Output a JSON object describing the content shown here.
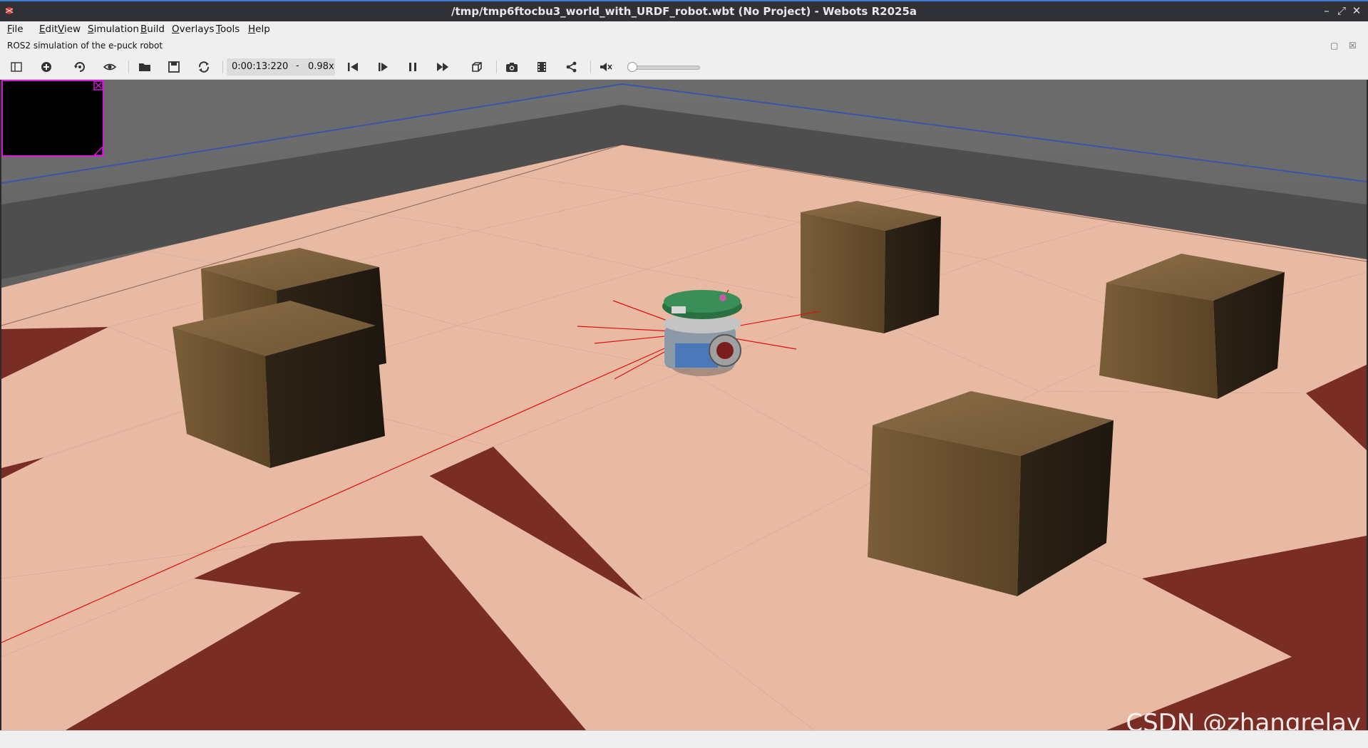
{
  "window": {
    "title": "/tmp/tmp6ftocbu3_world_with_URDF_robot.wbt (No Project) - Webots R2025a",
    "controls": [
      "minimize-icon",
      "maximize-icon",
      "close-icon"
    ]
  },
  "menu": {
    "items": [
      "File",
      "Edit",
      "View",
      "Simulation",
      "Build",
      "Overlays",
      "Tools",
      "Help"
    ]
  },
  "info": {
    "description": "ROS2 simulation of the e-puck robot"
  },
  "toolbar": {
    "icons": [
      "scene-tree-toggle-icon",
      "add-node-icon",
      "reload-controller-icon",
      "view-eye-icon",
      "open-world-icon",
      "save-world-icon",
      "reload-world-icon",
      "step-back-icon",
      "step-icon",
      "pause-icon",
      "fast-forward-icon",
      "view-cube-icon",
      "screenshot-icon",
      "record-movie-icon",
      "share-icon",
      "mute-icon"
    ],
    "time": "0:00:13:220",
    "time_separator": "-",
    "speed": "0.98x",
    "volume_level": 0
  },
  "viewport": {
    "watermark": "CSDN @zhangrelay",
    "colors": {
      "tile_light": "#e8b9a3",
      "tile_dark": "#7a2d25",
      "wall": "#5a5a5a",
      "crate": "#6b4e2e",
      "camera_border": "#d21bd6"
    }
  }
}
